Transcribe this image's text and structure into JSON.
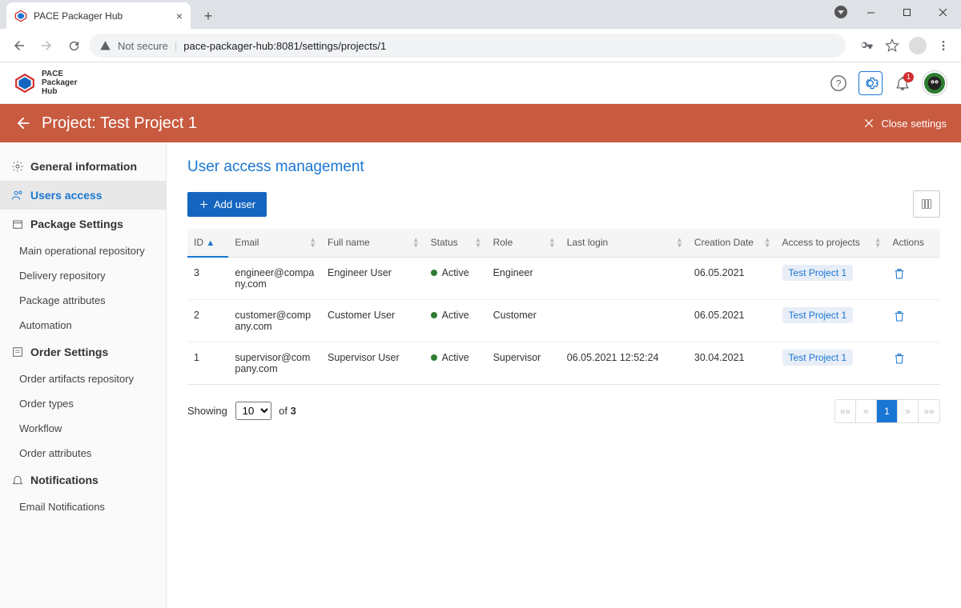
{
  "browser": {
    "tab_title": "PACE Packager Hub",
    "url_warning": "Not secure",
    "url_display": "pace-packager-hub:8081/settings/projects/1"
  },
  "app": {
    "logo_line1": "PACE",
    "logo_line2": "Packager",
    "logo_line3": "Hub",
    "notification_badge": "1"
  },
  "proj_bar": {
    "title": "Project: Test Project 1",
    "close_label": "Close settings"
  },
  "sidebar": {
    "sec_general": "General information",
    "sec_users": "Users access",
    "sec_package": "Package Settings",
    "pkg_links": [
      "Main operational repository",
      "Delivery repository",
      "Package attributes",
      "Automation"
    ],
    "sec_order": "Order Settings",
    "order_links": [
      "Order artifacts repository",
      "Order types",
      "Workflow",
      "Order attributes"
    ],
    "sec_notif": "Notifications",
    "notif_links": [
      "Email Notifications"
    ]
  },
  "main": {
    "title": "User access management",
    "add_user": "Add user",
    "columns": {
      "id": "ID",
      "email": "Email",
      "fullname": "Full name",
      "status": "Status",
      "role": "Role",
      "lastlogin": "Last login",
      "creation": "Creation Date",
      "access": "Access to projects",
      "actions": "Actions"
    },
    "rows": [
      {
        "id": "3",
        "email": "engineer@company.com",
        "fullname": "Engineer User",
        "status": "Active",
        "role": "Engineer",
        "lastlogin": "",
        "creation": "06.05.2021",
        "access": "Test Project 1"
      },
      {
        "id": "2",
        "email": "customer@company.com",
        "fullname": "Customer User",
        "status": "Active",
        "role": "Customer",
        "lastlogin": "",
        "creation": "06.05.2021",
        "access": "Test Project 1"
      },
      {
        "id": "1",
        "email": "supervisor@company.com",
        "fullname": "Supervisor User",
        "status": "Active",
        "role": "Supervisor",
        "lastlogin": "06.05.2021 12:52:24",
        "creation": "30.04.2021",
        "access": "Test Project 1"
      }
    ],
    "footer": {
      "showing": "Showing",
      "page_size": "10",
      "of": "of",
      "total": "3",
      "current_page": "1"
    }
  }
}
